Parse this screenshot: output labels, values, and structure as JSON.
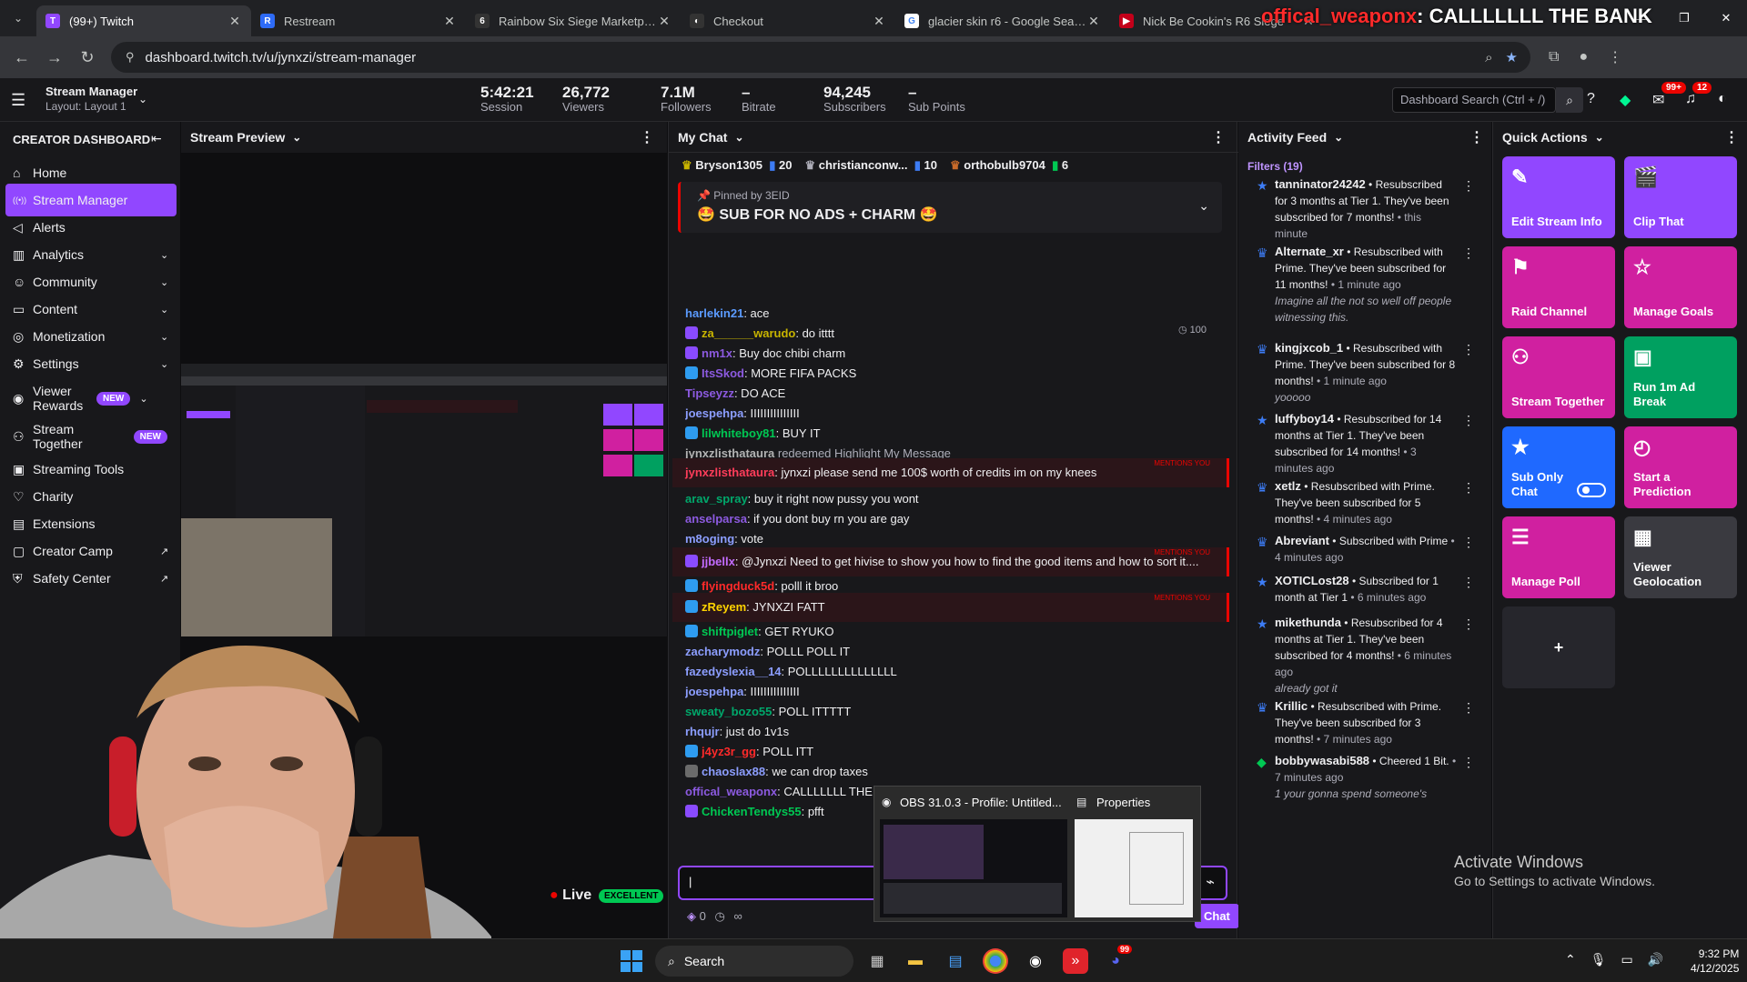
{
  "browser": {
    "tabs": [
      {
        "title": "(99+) Twitch",
        "fav_color": "#9147ff",
        "fav_glyph": "T"
      },
      {
        "title": "Restream",
        "fav_color": "#2e6bf6",
        "fav_glyph": "R"
      },
      {
        "title": "Rainbow Six Siege Marketplace",
        "fav_color": "#333333",
        "fav_glyph": "6"
      },
      {
        "title": "Checkout",
        "fav_color": "#333333",
        "fav_glyph": "◐"
      },
      {
        "title": "glacier skin r6 - Google Search",
        "fav_color": "#ffffff",
        "fav_glyph": "G"
      },
      {
        "title": "Nick Be Cookin's R6 Siege",
        "fav_color": "#c4001a",
        "fav_glyph": "▶"
      }
    ],
    "url": "dashboard.twitch.tv/u/jynxzi/stream-manager"
  },
  "overlay": {
    "donor": "offical_weaponx",
    "message": ": CALLLLLLL THE BANK"
  },
  "header": {
    "title": "Stream Manager",
    "layout": "Layout: Layout 1",
    "search_placeholder": "Dashboard Search (Ctrl + /)",
    "notif_badge": "99+",
    "inbox_badge": "12",
    "stats": [
      {
        "value": "5:42:21",
        "label": "Session"
      },
      {
        "value": "26,772",
        "label": "Viewers"
      },
      {
        "value": "7.1M",
        "label": "Followers"
      },
      {
        "value": "–",
        "label": "Bitrate"
      },
      {
        "value": "94,245",
        "label": "Subscribers"
      },
      {
        "value": "–",
        "label": "Sub Points"
      }
    ]
  },
  "sidebar": {
    "title": "CREATOR DASHBOARD",
    "items": [
      {
        "label": "Home",
        "icon": "⌂",
        "chev": "",
        "new": ""
      },
      {
        "label": "Stream Manager",
        "icon": "((•))",
        "chev": "",
        "new": ""
      },
      {
        "label": "Alerts",
        "icon": "◁",
        "chev": "",
        "new": ""
      },
      {
        "label": "Analytics",
        "icon": "▥",
        "chev": "⌄",
        "new": ""
      },
      {
        "label": "Community",
        "icon": "☺",
        "chev": "⌄",
        "new": ""
      },
      {
        "label": "Content",
        "icon": "▭",
        "chev": "⌄",
        "new": ""
      },
      {
        "label": "Monetization",
        "icon": "◎",
        "chev": "⌄",
        "new": ""
      },
      {
        "label": "Settings",
        "icon": "⚙",
        "chev": "⌄",
        "new": ""
      },
      {
        "label": "Viewer Rewards",
        "icon": "◉",
        "chev": "⌄",
        "new": "NEW"
      },
      {
        "label": "Stream Together",
        "icon": "⚇",
        "chev": "",
        "new": "NEW"
      },
      {
        "label": "Streaming Tools",
        "icon": "▣",
        "chev": "",
        "new": ""
      },
      {
        "label": "Charity",
        "icon": "♡",
        "chev": "",
        "new": ""
      },
      {
        "label": "Extensions",
        "icon": "▤",
        "chev": "",
        "new": ""
      },
      {
        "label": "Creator Camp",
        "icon": "▢",
        "chev": "↗",
        "new": ""
      },
      {
        "label": "Safety Center",
        "icon": "⛨",
        "chev": "↗",
        "new": ""
      }
    ]
  },
  "preview": {
    "title": "Stream Preview",
    "live_label": "Live",
    "quality": "EXCELLENT"
  },
  "chat": {
    "title": "My Chat",
    "gifters": [
      {
        "count": "20",
        "name": "Bryson1305"
      },
      {
        "count": "10",
        "name": "christianconw..."
      },
      {
        "count": "6",
        "name": "orthobulb9704"
      }
    ],
    "pinned_by": "Pinned by 3EID",
    "pinned_msg": "🤩 SUB FOR NO ADS + CHARM 🤩",
    "messages": [
      {
        "user": "harlekin21",
        "text": ": ace",
        "color": "#5b9bff",
        "badge": "",
        "hl": false
      },
      {
        "user": "za______warudo",
        "text": ": do itttt",
        "color": "#c8b400",
        "badge": "#8a4bff",
        "hl": false
      },
      {
        "user": "nm1x",
        "text": ": Buy doc chibi charm",
        "color": "#8c5ae0",
        "badge": "#8a4bff",
        "hl": false
      },
      {
        "user": "ItsSkod",
        "text": ": MORE FIFA PACKS",
        "color": "#8c5ae0",
        "badge": "#2e9cf0",
        "hl": false
      },
      {
        "user": "Tipseyzz",
        "text": ": DO ACE",
        "color": "#8c5ae0",
        "badge": "",
        "hl": false
      },
      {
        "user": "joespehpa",
        "text": ": IIIIIIIIIIIIIII",
        "color": "#8c9eff",
        "badge": "",
        "hl": false
      },
      {
        "user": "lilwhiteboy81",
        "text": ": BUY IT",
        "color": "#00c853",
        "badge": "#2e9cf0",
        "hl": false
      },
      {
        "user": "jynxzlisthataura",
        "text": " redeemed Highlight My Message",
        "color": "#b3b3b3",
        "badge": "",
        "hl": false
      },
      {
        "user": "jynxzlisthataura",
        "text": ": jynxzi please send me 100$ worth of credits im on my knees",
        "color": "#ff3d5a",
        "badge": "",
        "hl": true
      },
      {
        "user": "arav_spray",
        "text": ": buy it right now pussy you wont",
        "color": "#00a86b",
        "badge": "",
        "hl": false
      },
      {
        "user": "anselparsa",
        "text": ": if you dont buy rn you are gay",
        "color": "#8c5ae0",
        "badge": "",
        "hl": false
      },
      {
        "user": "m8oging",
        "text": ": vote",
        "color": "#8c9eff",
        "badge": "",
        "hl": false
      },
      {
        "user": "jjbellx",
        "text": ": @Jynxzi Need to get hivise to show you how to find the good items and how to sort it....",
        "color": "#c36cff",
        "badge": "#8a4bff",
        "hl": true
      },
      {
        "user": "flyingduck5d",
        "text": ": polll it broo",
        "color": "#ff2a2a",
        "badge": "#2e9cf0",
        "hl": false
      },
      {
        "user": "zReyem",
        "text": ": JYNXZI FATT",
        "color": "#ffd400",
        "badge": "#2e9cf0",
        "hl": true
      },
      {
        "user": "shiftpiglet",
        "text": ": GET RYUKO",
        "color": "#00c853",
        "badge": "#2e9cf0",
        "hl": false
      },
      {
        "user": "zacharymodz",
        "text": ": POLLL POLL IT",
        "color": "#8c9eff",
        "badge": "",
        "hl": false
      },
      {
        "user": "fazedyslexia__14",
        "text": ": POLLLLLLLLLLLLLL",
        "color": "#8c9eff",
        "badge": "",
        "hl": false
      },
      {
        "user": "joespehpa",
        "text": ": IIIIIIIIIIIIIII",
        "color": "#8c9eff",
        "badge": "",
        "hl": false
      },
      {
        "user": "sweaty_bozo55",
        "text": ": POLL ITTTTT",
        "color": "#00a86b",
        "badge": "",
        "hl": false
      },
      {
        "user": "rhqujr",
        "text": ": just do 1v1s",
        "color": "#8c9eff",
        "badge": "",
        "hl": false
      },
      {
        "user": "j4yz3r_gg",
        "text": ": POLL ITT",
        "color": "#ff2a2a",
        "badge": "#2e9cf0",
        "hl": false
      },
      {
        "user": "chaoslax88",
        "text": ": we can drop taxes",
        "color": "#8c9eff",
        "badge": "#6b6b6b",
        "hl": false
      },
      {
        "user": "offical_weaponx",
        "text": ": CALLLLLLL THE BANK",
        "color": "#8c5ae0",
        "badge": "",
        "hl": false
      },
      {
        "user": "ChickenTendys55",
        "text": ": pfft",
        "color": "#00c853",
        "badge": "#8a4bff",
        "hl": false
      }
    ],
    "mentions_label": "MENTIONS YOU",
    "redeem_cost": "100",
    "bits": "0",
    "chat_button": "Chat"
  },
  "obs": {
    "title": "OBS 31.0.3 - Profile: Untitled...",
    "props": "Properties"
  },
  "activity": {
    "title": "Activity Feed",
    "filters": "Filters (19)",
    "items": [
      {
        "user": "tanninator24242",
        "body": " • Resubscribed for 3 months at Tier 1. They've been subscribed for 7 months!",
        "time": " • this minute",
        "quote": "",
        "icon": "★"
      },
      {
        "user": "Alternate_xr",
        "body": " • Resubscribed with Prime. They've been subscribed for 11 months!",
        "time": " • 1 minute ago",
        "quote": "Imagine all the not so well off people witnessing this.",
        "icon": "♛"
      },
      {
        "user": "kingjxcob_1",
        "body": " • Resubscribed with Prime. They've been subscribed for 8 months!",
        "time": " • 1 minute ago",
        "quote": "yooooo",
        "icon": "♛"
      },
      {
        "user": "luffyboy14",
        "body": " • Resubscribed for 14 months at Tier 1. They've been subscribed for 14 months!",
        "time": " • 3 minutes ago",
        "quote": "",
        "icon": "★"
      },
      {
        "user": "xetlz",
        "body": " • Resubscribed with Prime. They've been subscribed for 5 months!",
        "time": " • 4 minutes ago",
        "quote": "",
        "icon": "♛"
      },
      {
        "user": "Abreviant",
        "body": " • Subscribed with Prime",
        "time": " • 4 minutes ago",
        "quote": "",
        "icon": "♛"
      },
      {
        "user": "XOTICLost28",
        "body": " • Subscribed for 1 month at Tier 1",
        "time": " • 6 minutes ago",
        "quote": "",
        "icon": "★"
      },
      {
        "user": "mikethunda",
        "body": " • Resubscribed for 4 months at Tier 1. They've been subscribed for 4 months!",
        "time": " • 6 minutes ago",
        "quote": "already got it",
        "icon": "★"
      },
      {
        "user": "Krillic",
        "body": " • Resubscribed with Prime. They've been subscribed for 3 months!",
        "time": " • 7 minutes ago",
        "quote": "",
        "icon": "♛"
      },
      {
        "user": "bobbywasabi588",
        "body": " • Cheered 1 Bit.",
        "time": " • 7 minutes ago",
        "quote": "1 your gonna spend someone's",
        "icon": "◆"
      }
    ]
  },
  "quick_actions": {
    "title": "Quick Actions",
    "items": [
      {
        "label": "Edit Stream Info",
        "icon": "✎",
        "color": "#9147ff"
      },
      {
        "label": "Clip That",
        "icon": "🎬",
        "color": "#9147ff"
      },
      {
        "label": "Raid Channel",
        "icon": "⚑",
        "color": "#d020a0"
      },
      {
        "label": "Manage Goals",
        "icon": "☆",
        "color": "#d020a0"
      },
      {
        "label": "Stream Together",
        "icon": "⚇",
        "color": "#d020a0"
      },
      {
        "label": "Run 1m Ad Break",
        "icon": "▣",
        "color": "#00a060"
      },
      {
        "label": "Sub Only Chat",
        "icon": "★",
        "color": "#1f69ff"
      },
      {
        "label": "Start a Prediction",
        "icon": "◴",
        "color": "#d020a0"
      },
      {
        "label": "Manage Poll",
        "icon": "☰",
        "color": "#d020a0"
      },
      {
        "label": "Viewer Geolocation",
        "icon": "▦",
        "color": "#3a3a40"
      }
    ],
    "add": "+"
  },
  "windows": {
    "activate_title": "Activate Windows",
    "activate_sub": "Go to Settings to activate Windows.",
    "search": "Search",
    "time": "9:32 PM",
    "date": "4/12/2025",
    "discord_badge": "99"
  }
}
